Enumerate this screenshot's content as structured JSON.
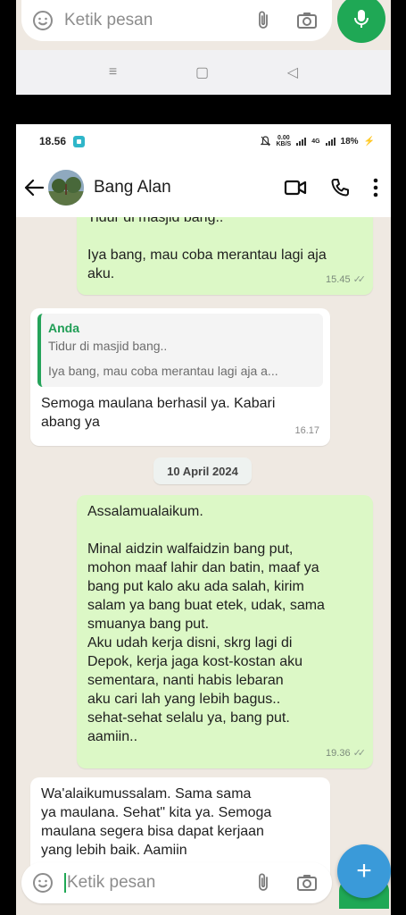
{
  "top_screen": {
    "input_placeholder": "Ketik pesan",
    "nav": {
      "menu": "≡",
      "home": "▢",
      "back": "◁"
    }
  },
  "status_bar": {
    "time": "18.56",
    "speed_value": "0.00",
    "speed_unit": "KB/S",
    "network": "4G",
    "battery": "18%"
  },
  "header": {
    "contact_name": "Bang Alan"
  },
  "messages": [
    {
      "direction": "out",
      "lines": [
        "Tidur di masjid bang..",
        "",
        "Iya bang, mau coba merantau lagi aja",
        "aku."
      ],
      "time": "15.45",
      "ticks": "✓✓"
    },
    {
      "direction": "in",
      "quote": {
        "author": "Anda",
        "line1": "Tidur di masjid bang..",
        "line2": "Iya bang, mau coba merantau lagi aja a..."
      },
      "lines": [
        "Semoga maulana berhasil ya. Kabari",
        "abang ya"
      ],
      "time": "16.17"
    },
    {
      "direction": "out",
      "lines": [
        "Assalamualaikum.",
        "",
        "Minal aidzin walfaidzin bang put,",
        "mohon maaf lahir dan batin, maaf ya",
        "bang put kalo aku ada salah, kirim",
        "salam ya bang buat etek, udak, sama",
        "smuanya bang put.",
        "Aku udah kerja disni, skrg lagi di",
        "Depok, kerja jaga kost-kostan aku",
        "sementara, nanti habis lebaran",
        "aku cari lah yang lebih bagus..",
        "sehat-sehat selalu ya, bang put.",
        "aamiin.."
      ],
      "time": "19.36",
      "ticks": "✓✓"
    },
    {
      "direction": "in",
      "lines": [
        "Wa'alaikumussalam. Sama sama",
        "ya maulana. Sehat\" kita ya. Semoga",
        "maulana segera bisa dapat kerjaan",
        "yang lebih baik. Aamiin"
      ]
    }
  ],
  "date_separator": "10 April 2024",
  "composer": {
    "placeholder": "Ketik pesan",
    "fab_label": "+"
  },
  "colors": {
    "outgoing_bubble": "#dcf8c6",
    "incoming_bubble": "#ffffff",
    "accent_green": "#1fa855",
    "fab_blue": "#3a9ad9",
    "chat_background": "#efe9e2"
  }
}
